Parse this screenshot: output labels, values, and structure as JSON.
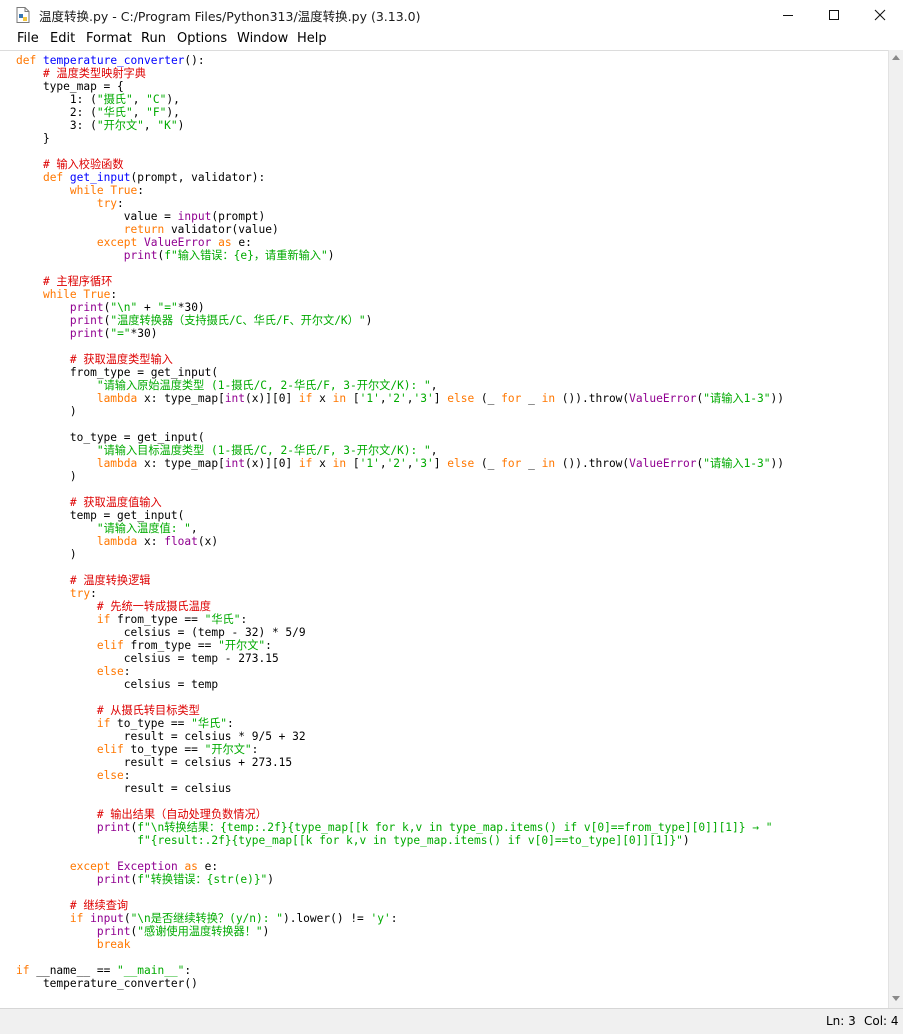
{
  "window": {
    "title": "温度转换.py - C:/Program Files/Python313/温度转换.py (3.13.0)",
    "controls": {
      "minimize": "—",
      "maximize": "☐",
      "close": "✕"
    }
  },
  "menu": {
    "file": "File",
    "edit": "Edit",
    "format": "Format",
    "run": "Run",
    "options": "Options",
    "window": "Window",
    "help": "Help"
  },
  "syntax_colors": {
    "keyword": "#ff7700",
    "definition": "#0000ff",
    "builtin": "#900090",
    "string": "#00aa00",
    "comment": "#dd0000"
  },
  "code": {
    "language": "python",
    "lines": [
      "def temperature_converter():",
      "    # 温度类型映射字典",
      "    type_map = {",
      "        1: (\"摄氏\", \"C\"),",
      "        2: (\"华氏\", \"F\"),",
      "        3: (\"开尔文\", \"K\")",
      "    }",
      "",
      "    # 输入校验函数",
      "    def get_input(prompt, validator):",
      "        while True:",
      "            try:",
      "                value = input(prompt)",
      "                return validator(value)",
      "            except ValueError as e:",
      "                print(f\"输入错误：{e}，请重新输入\")",
      "",
      "    # 主程序循环",
      "    while True:",
      "        print(\"\\n\" + \"=\"*30)",
      "        print(\"温度转换器（支持摄氏/C、华氏/F、开尔文/K）\")",
      "        print(\"=\"*30)",
      "",
      "        # 获取温度类型输入",
      "        from_type = get_input(",
      "            \"请输入原始温度类型 (1-摄氏/C, 2-华氏/F, 3-开尔文/K): \",",
      "            lambda x: type_map[int(x)][0] if x in ['1','2','3'] else (_ for _ in ()).throw(ValueError(\"请输入1-3\"))",
      "        )",
      "",
      "        to_type = get_input(",
      "            \"请输入目标温度类型 (1-摄氏/C, 2-华氏/F, 3-开尔文/K): \",",
      "            lambda x: type_map[int(x)][0] if x in ['1','2','3'] else (_ for _ in ()).throw(ValueError(\"请输入1-3\"))",
      "        )",
      "",
      "        # 获取温度值输入",
      "        temp = get_input(",
      "            \"请输入温度值: \",",
      "            lambda x: float(x)",
      "        )",
      "",
      "        # 温度转换逻辑",
      "        try:",
      "            # 先统一转成摄氏温度",
      "            if from_type == \"华氏\":",
      "                celsius = (temp - 32) * 5/9",
      "            elif from_type == \"开尔文\":",
      "                celsius = temp - 273.15",
      "            else:",
      "                celsius = temp",
      "",
      "            # 从摄氏转目标类型",
      "            if to_type == \"华氏\":",
      "                result = celsius * 9/5 + 32",
      "            elif to_type == \"开尔文\":",
      "                result = celsius + 273.15",
      "            else:",
      "                result = celsius",
      "",
      "            # 输出结果（自动处理负数情况）",
      "            print(f\"\\n转换结果：{temp:.2f}{type_map[[k for k,v in type_map.items() if v[0]==from_type][0]][1]} → \"",
      "                  f\"{result:.2f}{type_map[[k for k,v in type_map.items() if v[0]==to_type][0]][1]}\")",
      "",
      "        except Exception as e:",
      "            print(f\"转换错误：{str(e)}\")",
      "",
      "        # 继续查询",
      "        if input(\"\\n是否继续转换？(y/n): \").lower() != 'y':",
      "            print(\"感谢使用温度转换器！\")",
      "            break",
      "",
      "if __name__ == \"__main__\":",
      "    temperature_converter()"
    ]
  },
  "status": {
    "line": "Ln: 3",
    "col": "Col: 4"
  }
}
